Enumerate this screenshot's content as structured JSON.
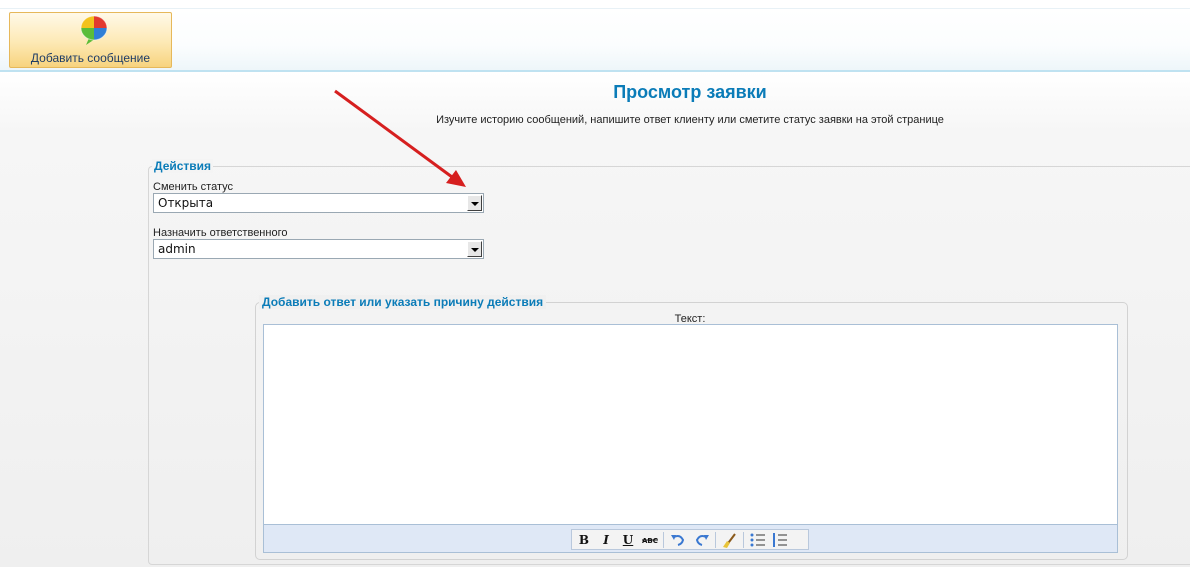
{
  "toolbar": {
    "add_message_label": "Добавить сообщение"
  },
  "header": {
    "title": "Просмотр заявки",
    "subtitle": "Изучите историю сообщений, напишите ответ клиенту или сметите статус заявки на этой странице"
  },
  "actions": {
    "legend": "Действия",
    "status_label": "Сменить статус",
    "status_value": "Открыта",
    "assignee_label": "Назначить ответственного",
    "assignee_value": "admin"
  },
  "reply": {
    "legend": "Добавить ответ или указать причину действия",
    "text_label": "Текст:",
    "editor_buttons": [
      "bold-icon",
      "italic-icon",
      "underline-icon",
      "strikethrough-icon",
      "undo-icon",
      "redo-icon",
      "clean-formatting-icon",
      "bullet-list-icon",
      "numbered-list-icon"
    ]
  },
  "colors": {
    "accent_blue": "#0b7cb8",
    "annotation_arrow": "#d61f1f",
    "button_gold": "#f7d37e"
  }
}
